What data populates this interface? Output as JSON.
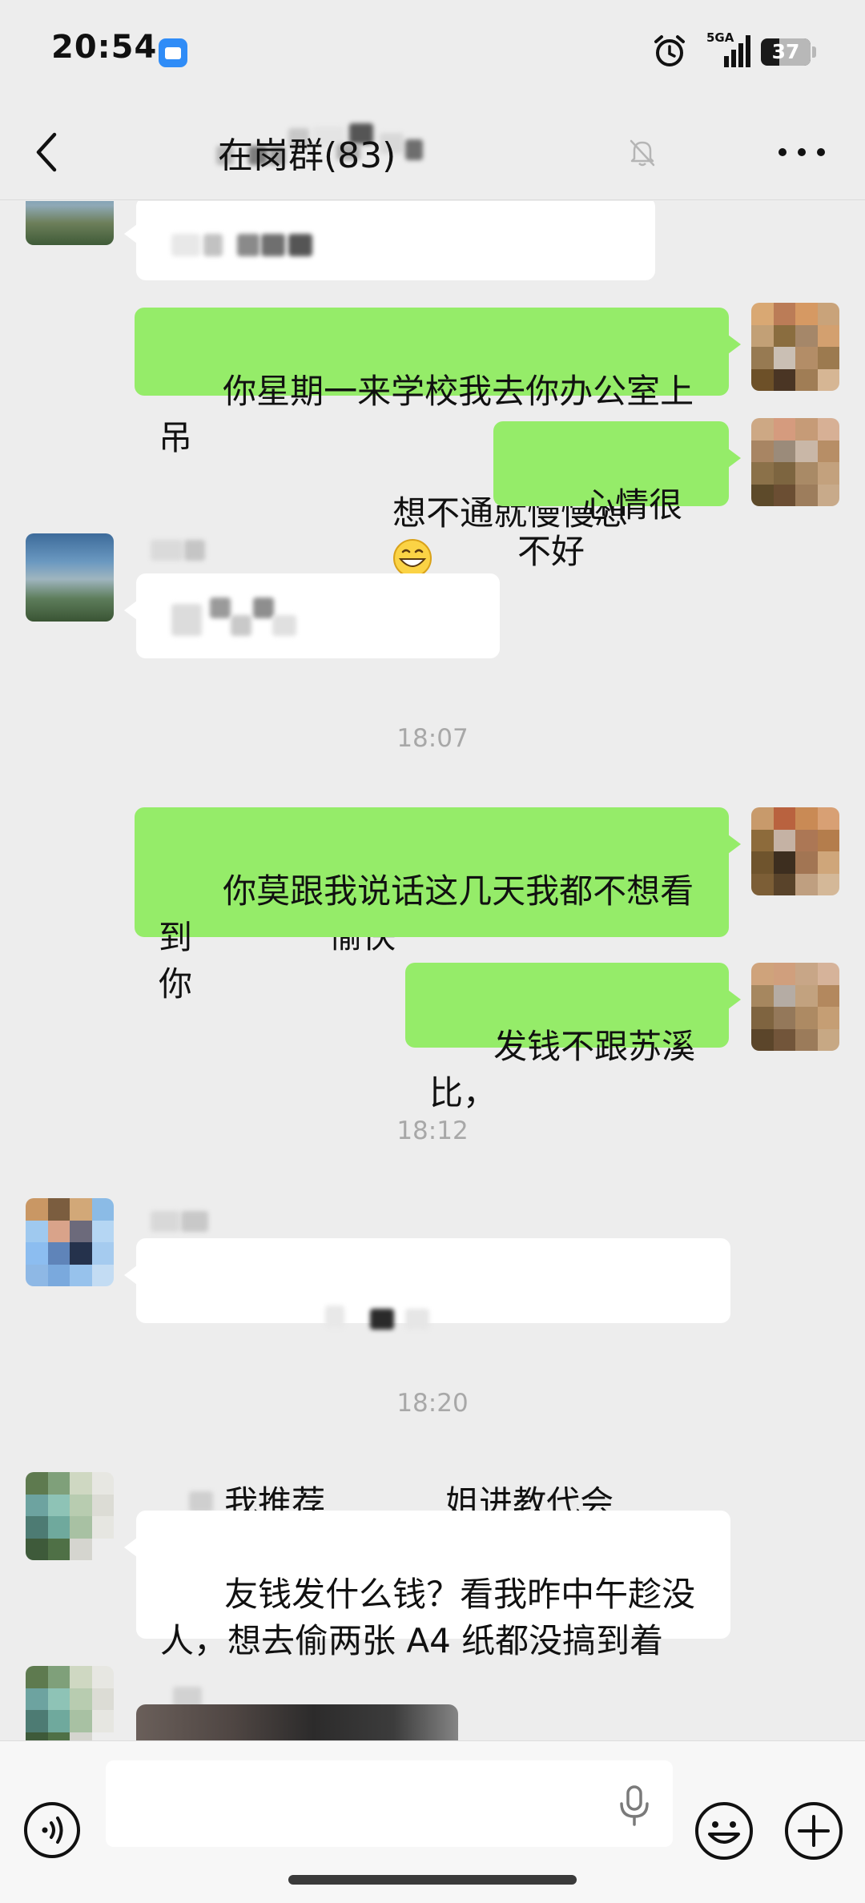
{
  "status_bar": {
    "time": "20:54",
    "network": "5GA",
    "battery": "37",
    "battery_level": 0.37,
    "icons": [
      "app-notification-icon",
      "alarm-icon",
      "signal-icon",
      "battery-icon"
    ]
  },
  "nav": {
    "title": "在岗群(83)",
    "icons": [
      "back-arrow-icon",
      "mute-bell-icon",
      "more-dots-icon"
    ]
  },
  "messages": [
    {
      "direction": "in",
      "text": "想不通就慢慢想",
      "emoji_count": 1
    },
    {
      "direction": "out",
      "text": "你星期一来学校我去你办公室上吊"
    },
    {
      "direction": "out",
      "text": "心情很不好"
    },
    {
      "direction": "in",
      "text": "周末愉快"
    },
    {
      "type": "time",
      "text": "18:07"
    },
    {
      "direction": "out",
      "text": "你莫跟我说话这几天我都不想看到\n你"
    },
    {
      "direction": "out",
      "text": "发钱不跟苏溪比，"
    },
    {
      "type": "time",
      "text": "18:12"
    },
    {
      "direction": "in",
      "text_before": "我推荐",
      "text_after": "姐进教代会",
      "emoji_count": 3
    },
    {
      "type": "time",
      "text": "18:20"
    },
    {
      "direction": "in",
      "text": "友钱发什么钱？看我昨中午趁没\n人，想去偷两张 A4 纸都没搞到着"
    }
  ],
  "input_bar": {
    "placeholder": "",
    "icons": [
      "voice-icon",
      "microphone-icon",
      "emoji-icon",
      "plus-icon"
    ]
  },
  "colors": {
    "background": "#ededed",
    "outgoing_bubble": "#95ec69",
    "incoming_bubble": "#ffffff",
    "timestamp": "#a8a8a8"
  }
}
